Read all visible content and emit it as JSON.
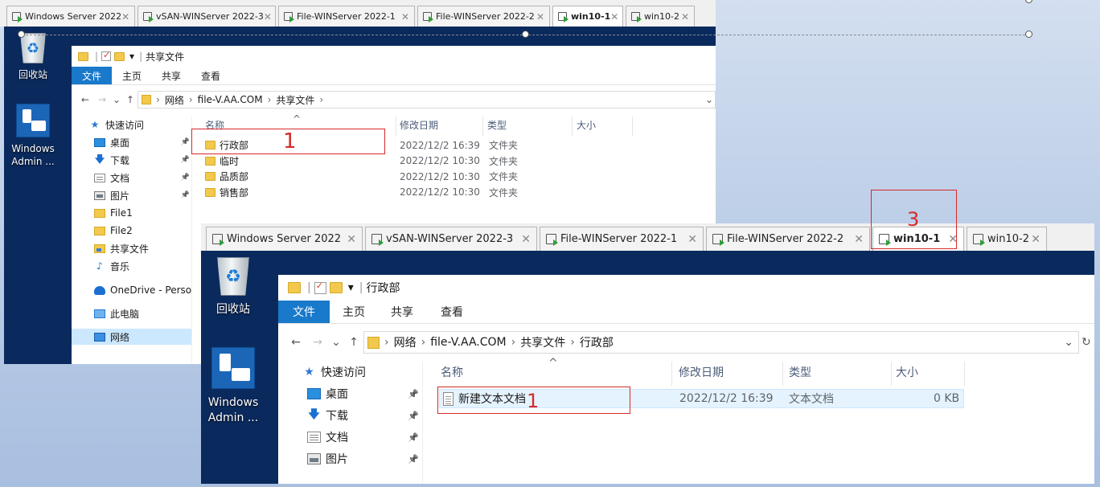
{
  "back_window": {
    "tabs": [
      {
        "label": "Windows Server 2022",
        "active": false
      },
      {
        "label": "vSAN-WINServer 2022-3",
        "active": false
      },
      {
        "label": "File-WINServer 2022-1",
        "active": false
      },
      {
        "label": "File-WINServer 2022-2",
        "active": false
      },
      {
        "label": "win10-1",
        "active": true
      },
      {
        "label": "win10-2",
        "active": false
      }
    ],
    "desktop_icons": [
      {
        "label": "回收站",
        "icon": "recycle-bin-icon"
      },
      {
        "label": "Windows Admin ...",
        "icon": "windows-admin-center-icon"
      }
    ],
    "explorer": {
      "title": "共享文件",
      "ribbon_tabs": [
        "文件",
        "主页",
        "共享",
        "查看"
      ],
      "address": [
        "网络",
        "file-V.AA.COM",
        "共享文件"
      ],
      "nav": [
        {
          "label": "快速访问",
          "icon": "star-icon",
          "pinned": false
        },
        {
          "label": "桌面",
          "icon": "desktop-icon",
          "pinned": true
        },
        {
          "label": "下载",
          "icon": "download-icon",
          "pinned": true
        },
        {
          "label": "文档",
          "icon": "document-icon",
          "pinned": true
        },
        {
          "label": "图片",
          "icon": "picture-icon",
          "pinned": true
        },
        {
          "label": "File1",
          "icon": "folder-icon",
          "pinned": false
        },
        {
          "label": "File2",
          "icon": "folder-icon",
          "pinned": false
        },
        {
          "label": "共享文件",
          "icon": "network-folder-icon",
          "pinned": false
        },
        {
          "label": "音乐",
          "icon": "music-icon",
          "pinned": false
        },
        {
          "label": "OneDrive - Persona",
          "icon": "onedrive-icon",
          "pinned": false
        },
        {
          "label": "此电脑",
          "icon": "this-pc-icon",
          "pinned": false
        },
        {
          "label": "网络",
          "icon": "network-icon",
          "pinned": false,
          "selected": true
        }
      ],
      "columns": {
        "name": "名称",
        "date": "修改日期",
        "type": "类型",
        "size": "大小"
      },
      "rows": [
        {
          "name": "行政部",
          "date": "2022/12/2 16:39",
          "type": "文件夹"
        },
        {
          "name": "临时",
          "date": "2022/12/2 10:30",
          "type": "文件夹"
        },
        {
          "name": "品质部",
          "date": "2022/12/2 10:30",
          "type": "文件夹"
        },
        {
          "name": "销售部",
          "date": "2022/12/2 10:30",
          "type": "文件夹"
        }
      ]
    },
    "annotation_label": "1"
  },
  "front_window": {
    "tabs": [
      {
        "label": "Windows Server 2022",
        "active": false
      },
      {
        "label": "vSAN-WINServer 2022-3",
        "active": false
      },
      {
        "label": "File-WINServer 2022-1",
        "active": false
      },
      {
        "label": "File-WINServer 2022-2",
        "active": false
      },
      {
        "label": "win10-1",
        "active": true
      },
      {
        "label": "win10-2",
        "active": false
      }
    ],
    "tab_annotation_label": "3",
    "desktop_icons": [
      {
        "label": "回收站",
        "icon": "recycle-bin-icon"
      },
      {
        "label": "Windows Admin ...",
        "icon": "windows-admin-center-icon"
      }
    ],
    "explorer": {
      "title": "行政部",
      "ribbon_tabs": [
        "文件",
        "主页",
        "共享",
        "查看"
      ],
      "address": [
        "网络",
        "file-V.AA.COM",
        "共享文件",
        "行政部"
      ],
      "nav": [
        {
          "label": "快速访问",
          "icon": "star-icon",
          "pinned": false
        },
        {
          "label": "桌面",
          "icon": "desktop-icon",
          "pinned": true
        },
        {
          "label": "下载",
          "icon": "download-icon",
          "pinned": true
        },
        {
          "label": "文档",
          "icon": "document-icon",
          "pinned": true
        },
        {
          "label": "图片",
          "icon": "picture-icon",
          "pinned": true
        }
      ],
      "columns": {
        "name": "名称",
        "date": "修改日期",
        "type": "类型",
        "size": "大小"
      },
      "rows": [
        {
          "name": "新建文本文档",
          "date": "2022/12/2 16:39",
          "type": "文本文档",
          "size": "0 KB"
        }
      ]
    },
    "annotation_label": "1"
  },
  "glyphs": {
    "close": "✕",
    "back": "←",
    "forward": "→",
    "recent": "⌄",
    "up": "↑",
    "chevron": "›",
    "dropdown": "⌄",
    "refresh": "↻",
    "pin": "📌",
    "sort": "^",
    "qa_dropdown": "▾",
    "qa_sep": "|"
  }
}
